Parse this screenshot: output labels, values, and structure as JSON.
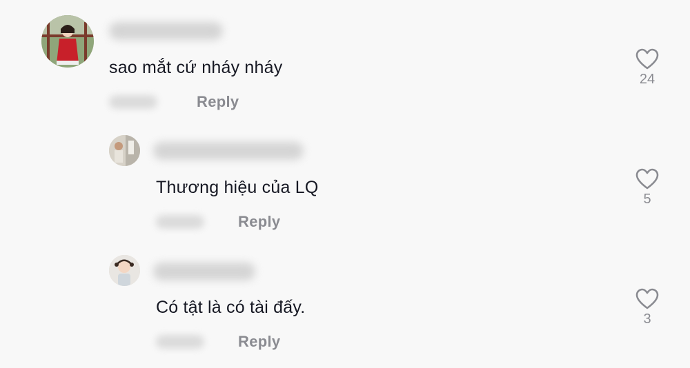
{
  "comments": [
    {
      "text": "sao mắt cứ nháy nháy",
      "reply_label": "Reply",
      "likes": "24",
      "avatar_icon": "avatar-girl-red-dress"
    },
    {
      "text": "Thương hiệu của LQ",
      "reply_label": "Reply",
      "likes": "5",
      "avatar_icon": "avatar-photo"
    },
    {
      "text": "Có tật là có tài đấy.",
      "reply_label": "Reply",
      "likes": "3",
      "avatar_icon": "avatar-child"
    }
  ],
  "icons": {
    "like": "heart-outline-icon"
  },
  "colors": {
    "background": "#f8f8f8",
    "text": "#161823",
    "muted": "#8a8b91"
  }
}
